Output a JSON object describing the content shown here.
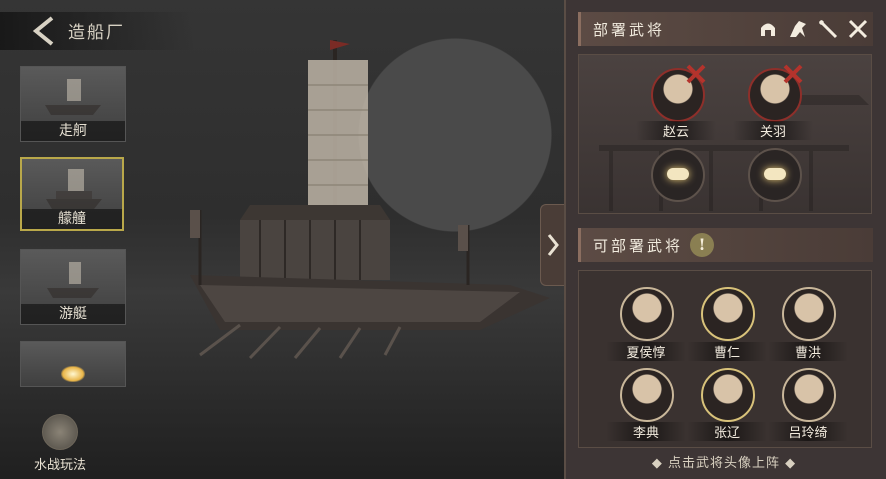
{
  "header": {
    "title": "造船厂"
  },
  "ships": [
    {
      "label": "走舸",
      "selected": false
    },
    {
      "label": "艨艟",
      "selected": true
    },
    {
      "label": "游艇",
      "selected": false
    },
    {
      "label": "",
      "selected": false
    }
  ],
  "naval": {
    "label": "水战玩法"
  },
  "deployed": {
    "title": "部署武将",
    "generals": [
      {
        "name": "赵云"
      },
      {
        "name": "关羽"
      }
    ]
  },
  "available": {
    "title": "可部署武将",
    "generals": [
      {
        "name": "夏侯惇"
      },
      {
        "name": "曹仁"
      },
      {
        "name": "曹洪"
      },
      {
        "name": "李典"
      },
      {
        "name": "张辽"
      },
      {
        "name": "吕玲绮"
      }
    ],
    "hint": "点击武将头像上阵"
  },
  "colors": {
    "panel": "#3d3535",
    "accent_gold": "#b9a84a",
    "remove_red": "#b4332c"
  }
}
